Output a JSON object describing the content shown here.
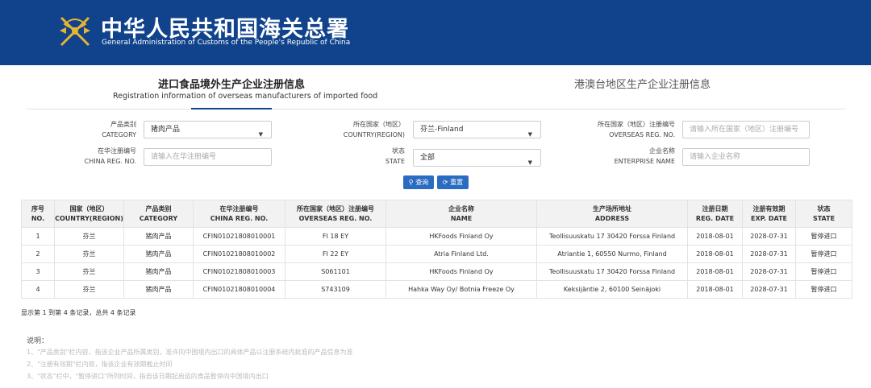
{
  "header": {
    "brand_cn": "中华人民共和国海关总署",
    "brand_en": "General Administration of Customs of the People's Republic of China",
    "logo_icon": "customs-emblem-icon",
    "bg_color": "#10438c"
  },
  "tabs": {
    "active_cn": "进口食品境外生产企业注册信息",
    "active_en": "Registration information of overseas manufacturers of imported food",
    "other": "港澳台地区生产企业注册信息"
  },
  "filters": {
    "category": {
      "label_cn": "产品类别",
      "label_en": "CATEGORY",
      "value": "猪肉产品"
    },
    "country": {
      "label_cn": "所在国家（地区）",
      "label_en": "COUNTRY(REGION)",
      "value": "芬兰-Finland"
    },
    "overseas_reg": {
      "label_cn": "所在国家（地区）注册编号",
      "label_en": "OVERSEAS REG. NO.",
      "placeholder": "请输入所在国家（地区）注册编号"
    },
    "china_reg": {
      "label_cn": "在华注册编号",
      "label_en": "CHINA REG. NO.",
      "placeholder": "请输入在华注册编号"
    },
    "state": {
      "label_cn": "状态",
      "label_en": "STATE",
      "value": "全部"
    },
    "enterprise": {
      "label_cn": "企业名称",
      "label_en": "ENTERPRISE NAME",
      "placeholder": "请输入企业名称"
    }
  },
  "buttons": {
    "query": "查询",
    "reset": "重置",
    "query_icon": "search-icon",
    "reset_icon": "refresh-icon",
    "color": "#2b6cc3"
  },
  "table": {
    "headers": [
      {
        "cn": "序号",
        "en": "NO."
      },
      {
        "cn": "国家（地区）",
        "en": "COUNTRY(REGION)"
      },
      {
        "cn": "产品类别",
        "en": "CATEGORY"
      },
      {
        "cn": "在华注册编号",
        "en": "CHINA REG. NO."
      },
      {
        "cn": "所在国家（地区）注册编号",
        "en": "OVERSEAS REG. NO."
      },
      {
        "cn": "企业名称",
        "en": "NAME"
      },
      {
        "cn": "生产场所地址",
        "en": "ADDRESS"
      },
      {
        "cn": "注册日期",
        "en": "REG. DATE"
      },
      {
        "cn": "注册有效期",
        "en": "EXP. DATE"
      },
      {
        "cn": "状态",
        "en": "STATE"
      }
    ],
    "rows": [
      [
        "1",
        "芬兰",
        "猪肉产品",
        "CFIN01021808010001",
        "FI 18 EY",
        "HKFoods Finland Oy",
        "Teollisuuskatu 17 30420 Forssa Finland",
        "2018-08-01",
        "2028-07-31",
        "暂停进口"
      ],
      [
        "2",
        "芬兰",
        "猪肉产品",
        "CFIN01021808010002",
        "FI 22 EY",
        "Atria Finland Ltd.",
        "Atriantie 1, 60550 Nurmo, Finland",
        "2018-08-01",
        "2028-07-31",
        "暂停进口"
      ],
      [
        "3",
        "芬兰",
        "猪肉产品",
        "CFIN01021808010003",
        "S061101",
        "HKFoods Finland Oy",
        "Teollisuuskatu 17 30420 Forssa Finland",
        "2018-08-01",
        "2028-07-31",
        "暂停进口"
      ],
      [
        "4",
        "芬兰",
        "猪肉产品",
        "CFIN01021808010004",
        "S743109",
        "Hahka Way Oy/ Botnia Freeze Oy",
        "Keksijäntie 2, 60100 Seinäjoki",
        "2018-08-01",
        "2028-07-31",
        "暂停进口"
      ]
    ]
  },
  "pagination": "显示第 1 到第 4 条记录，总共 4 条记录",
  "notes": {
    "title": "说明：",
    "items": [
      "1、\"产品类别\"栏内容，指该企业产品所属类别，准许向中国境内出口的具体产品以注册系统内批准的产品信息为准",
      "2、\"注册有效期\"栏内容，指该企业有效期截止时间",
      "3、\"状态\"栏中，\"暂停进口\"所列时间，指自该日期起启运的食品暂停向中国境内出口"
    ]
  }
}
